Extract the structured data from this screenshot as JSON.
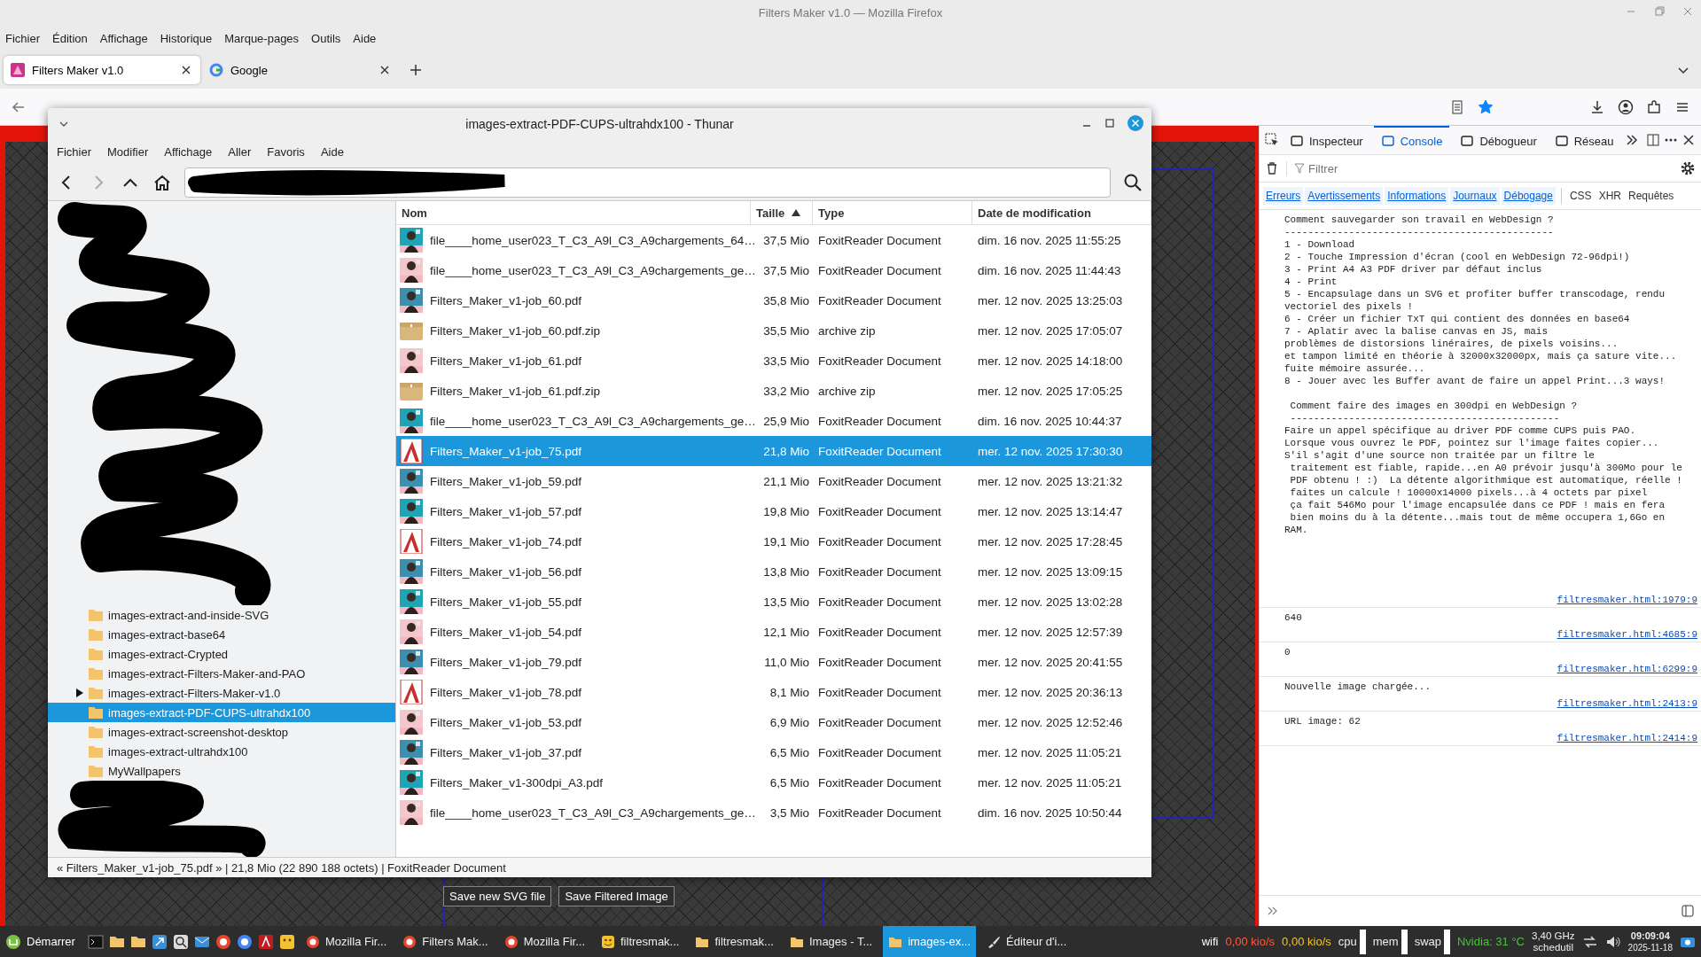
{
  "browser": {
    "title": "Filters Maker v1.0 — Mozilla Firefox",
    "menu": [
      "Fichier",
      "Édition",
      "Affichage",
      "Historique",
      "Marque-pages",
      "Outils",
      "Aide"
    ],
    "tabs": [
      {
        "label": "Filters Maker v1.0",
        "selected": true
      },
      {
        "label": "Google",
        "selected": false
      }
    ],
    "bookmarked": true
  },
  "page": {
    "buttons": [
      "Save new SVG file",
      "Save Filtered Image"
    ]
  },
  "file_manager": {
    "title": "images-extract-PDF-CUPS-ultrahdx100 - Thunar",
    "menu": [
      "Fichier",
      "Modifier",
      "Affichage",
      "Aller",
      "Favoris",
      "Aide"
    ],
    "can_go_forward": false,
    "sidebar": {
      "items": [
        {
          "label": "images-extract-and-inside-SVG",
          "has_children": false,
          "selected": false
        },
        {
          "label": "images-extract-base64",
          "has_children": false,
          "selected": false
        },
        {
          "label": "images-extract-Crypted",
          "has_children": false,
          "selected": false
        },
        {
          "label": "images-extract-Filters-Maker-and-PAO",
          "has_children": false,
          "selected": false
        },
        {
          "label": "images-extract-Filters-Maker-v1.0",
          "has_children": true,
          "selected": false
        },
        {
          "label": "images-extract-PDF-CUPS-ultrahdx100",
          "has_children": false,
          "selected": true
        },
        {
          "label": "images-extract-screenshot-desktop",
          "has_children": false,
          "selected": false
        },
        {
          "label": "images-extract-ultrahdx100",
          "has_children": false,
          "selected": false
        },
        {
          "label": "MyWallpapers",
          "has_children": false,
          "selected": false
        }
      ]
    },
    "columns": [
      {
        "label": "Nom",
        "sorted": false
      },
      {
        "label": "Taille",
        "sorted": true
      },
      {
        "label": "Type",
        "sorted": false
      },
      {
        "label": "Date de modification",
        "sorted": false
      }
    ],
    "files": [
      {
        "name": "file____home_user023_T_C3_A9l_C3_A9chargements_64…",
        "size": "37,5 Mio",
        "type": "FoxitReader Document",
        "modified": "dim. 16 nov. 2025 11:55:25",
        "selected": false
      },
      {
        "name": "file____home_user023_T_C3_A9l_C3_A9chargements_ge…",
        "size": "37,5 Mio",
        "type": "FoxitReader Document",
        "modified": "dim. 16 nov. 2025 11:44:43",
        "selected": false
      },
      {
        "name": "Filters_Maker_v1-job_60.pdf",
        "size": "35,8 Mio",
        "type": "FoxitReader Document",
        "modified": "mer. 12 nov. 2025 13:25:03",
        "selected": false
      },
      {
        "name": "Filters_Maker_v1-job_60.pdf.zip",
        "size": "35,5 Mio",
        "type": "archive zip",
        "modified": "mer. 12 nov. 2025 17:05:07",
        "kind": "zip",
        "selected": false
      },
      {
        "name": "Filters_Maker_v1-job_61.pdf",
        "size": "33,5 Mio",
        "type": "FoxitReader Document",
        "modified": "mer. 12 nov. 2025 14:18:00",
        "selected": false
      },
      {
        "name": "Filters_Maker_v1-job_61.pdf.zip",
        "size": "33,2 Mio",
        "type": "archive zip",
        "modified": "mer. 12 nov. 2025 17:05:25",
        "kind": "zip",
        "selected": false
      },
      {
        "name": "file____home_user023_T_C3_A9l_C3_A9chargements_ge…",
        "size": "25,9 Mio",
        "type": "FoxitReader Document",
        "modified": "dim. 16 nov. 2025 10:44:37",
        "selected": false
      },
      {
        "name": "Filters_Maker_v1-job_75.pdf",
        "size": "21,8 Mio",
        "type": "FoxitReader Document",
        "modified": "mer. 12 nov. 2025 17:30:30",
        "kind": "pdf",
        "selected": true
      },
      {
        "name": "Filters_Maker_v1-job_59.pdf",
        "size": "21,1 Mio",
        "type": "FoxitReader Document",
        "modified": "mer. 12 nov. 2025 13:21:32",
        "selected": false
      },
      {
        "name": "Filters_Maker_v1-job_57.pdf",
        "size": "19,8 Mio",
        "type": "FoxitReader Document",
        "modified": "mer. 12 nov. 2025 13:14:47",
        "selected": false
      },
      {
        "name": "Filters_Maker_v1-job_74.pdf",
        "size": "19,1 Mio",
        "type": "FoxitReader Document",
        "modified": "mer. 12 nov. 2025 17:28:45",
        "kind": "pdf",
        "selected": false
      },
      {
        "name": "Filters_Maker_v1-job_56.pdf",
        "size": "13,8 Mio",
        "type": "FoxitReader Document",
        "modified": "mer. 12 nov. 2025 13:09:15",
        "selected": false
      },
      {
        "name": "Filters_Maker_v1-job_55.pdf",
        "size": "13,5 Mio",
        "type": "FoxitReader Document",
        "modified": "mer. 12 nov. 2025 13:02:28",
        "selected": false
      },
      {
        "name": "Filters_Maker_v1-job_54.pdf",
        "size": "12,1 Mio",
        "type": "FoxitReader Document",
        "modified": "mer. 12 nov. 2025 12:57:39",
        "selected": false
      },
      {
        "name": "Filters_Maker_v1-job_79.pdf",
        "size": "11,0 Mio",
        "type": "FoxitReader Document",
        "modified": "mer. 12 nov. 2025 20:41:55",
        "selected": false
      },
      {
        "name": "Filters_Maker_v1-job_78.pdf",
        "size": "8,1 Mio",
        "type": "FoxitReader Document",
        "modified": "mer. 12 nov. 2025 20:36:13",
        "kind": "pdf",
        "selected": false
      },
      {
        "name": "Filters_Maker_v1-job_53.pdf",
        "size": "6,9 Mio",
        "type": "FoxitReader Document",
        "modified": "mer. 12 nov. 2025 12:52:46",
        "selected": false
      },
      {
        "name": "Filters_Maker_v1-job_37.pdf",
        "size": "6,5 Mio",
        "type": "FoxitReader Document",
        "modified": "mer. 12 nov. 2025 11:05:21",
        "selected": false
      },
      {
        "name": "Filters_Maker_v1-300dpi_A3.pdf",
        "size": "6,5 Mio",
        "type": "FoxitReader Document",
        "modified": "mer. 12 nov. 2025 11:05:21",
        "selected": false
      },
      {
        "name": "file____home_user023_T_C3_A9l_C3_A9chargements_ge…",
        "size": "3,5 Mio",
        "type": "FoxitReader Document",
        "modified": "dim. 16 nov. 2025 10:50:44",
        "selected": false
      }
    ],
    "status": "« Filters_Maker_v1-job_75.pdf » | 21,8 Mio (22 890 188 octets) | FoxitReader Document"
  },
  "devtools": {
    "tabs": [
      {
        "label": "Inspecteur",
        "selected": false
      },
      {
        "label": "Console",
        "selected": true
      },
      {
        "label": "Débogueur",
        "selected": false
      },
      {
        "label": "Réseau",
        "selected": false
      }
    ],
    "filter_placeholder": "Filtrer",
    "filters": [
      {
        "label": "Erreurs",
        "on": true
      },
      {
        "label": "Avertissements",
        "on": true
      },
      {
        "label": "Informations",
        "on": true
      },
      {
        "label": "Journaux",
        "on": true
      },
      {
        "label": "Débogage",
        "on": true
      },
      {
        "label": "CSS",
        "on": false
      },
      {
        "label": "XHR",
        "on": false
      },
      {
        "label": "Requêtes",
        "on": false
      }
    ],
    "messages": [
      {
        "text": "Comment sauvegarder son travail en WebDesign ?\n----------------------------------------------\n1 - Download\n2 - Touche Impression d'écran (cool en WebDesign 72-96dpi!)\n3 - Print A4 A3 PDF driver par défaut inclus\n4 - Print\n5 - Encapsulage dans un SVG et profiter buffer transcodage, rendu\nvectoriel des pixels !\n6 - Créer un fichier TxT qui contient des données en base64\n7 - Aplatir avec la balise canvas en JS, mais\nproblèmes de distorsions linéraires, de pixels voisins...\net tampon limité en théorie à 32000x32000px, mais ça sature vite...\nfuite mémoire assurée...\n8 - Jouer avec les Buffer avant de faire un appel Print...3 ways!\n\n Comment faire des images en 300dpi en WebDesign ?\n ----------------------------------------------\nFaire un appel spécifique au driver PDF comme CUPS puis PAO.\nLorsque vous ouvrez le PDF, pointez sur l'image faites copier...\nS'il s'agit d'une source non traitée par un filtre le\n traitement est fiable, rapide...en A0 prévoir jusqu'à 300Mo pour le\n PDF obtenu ! :)  La détente algorithmique est automatique, réelle !\n faites un calcule ! 10000x14000 pixels...à 4 octets par pixel\n ça fait 546Mo pour l'image encapsulée dans ce PDF ! mais en fera\n bien moins du à la détente...mais tout de même occupera 1,6Go en\nRAM.",
        "source": "filtresmaker.html:1979:9"
      },
      {
        "text": "640",
        "source": "filtresmaker.html:4685:9"
      },
      {
        "text": "0",
        "source": "filtresmaker.html:6299:9"
      },
      {
        "text": "Nouvelle image chargée...",
        "source": "filtresmaker.html:2413:9"
      },
      {
        "text": "URL image: 62",
        "source": "filtresmaker.html:2414:9"
      }
    ]
  },
  "taskbar": {
    "start": "Démarrer",
    "windows": [
      {
        "label": "Mozilla Fir...",
        "kind": "browser",
        "selected": false
      },
      {
        "label": "Filters Mak...",
        "kind": "browser",
        "selected": false
      },
      {
        "label": "Mozilla Fir...",
        "kind": "browser",
        "selected": false
      },
      {
        "label": "filtresmak...",
        "kind": "emoji",
        "selected": false
      },
      {
        "label": "filtresmak...",
        "kind": "folder",
        "selected": false
      },
      {
        "label": "Images - T...",
        "kind": "folder",
        "selected": false
      },
      {
        "label": "images-ex...",
        "kind": "folder",
        "selected": true
      },
      {
        "label": "Éditeur d'i...",
        "kind": "editor",
        "selected": false
      }
    ],
    "network": [
      {
        "text": "wifi",
        "color": "#ffffff"
      },
      {
        "text": "0,00 kio/s",
        "color": "#ff5a3c"
      },
      {
        "text": "0,00 kio/s",
        "color": "#f2c230"
      }
    ],
    "meters": [
      "cpu",
      "mem",
      "swap"
    ],
    "gpu": "Nvidia: 31 °C",
    "cpu_freq": "3,40 GHz",
    "governor": "schedutil",
    "time": "09:09:04",
    "date": "2025-11-18"
  }
}
